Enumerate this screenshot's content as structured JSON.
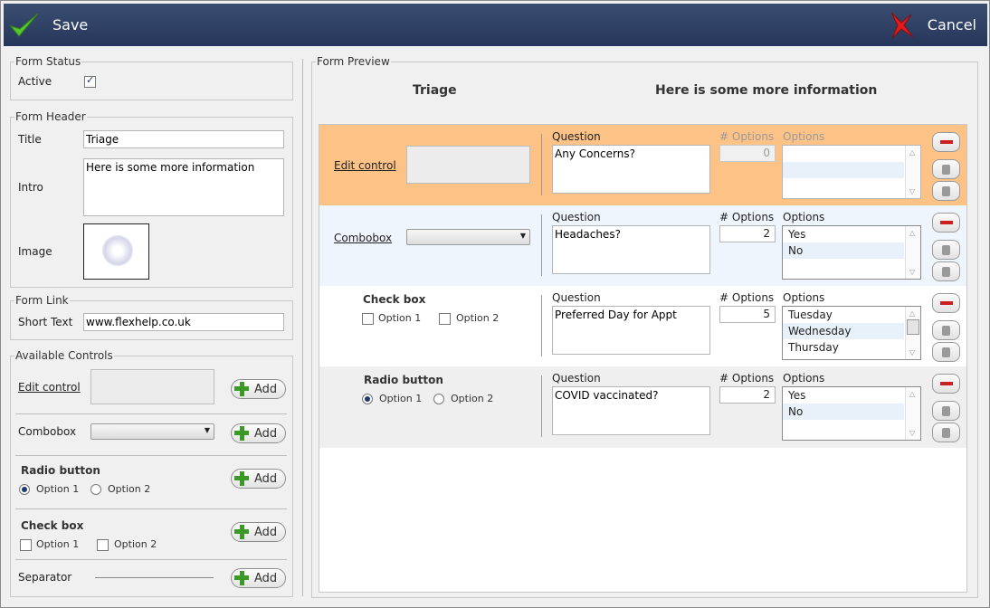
{
  "toolbar": {
    "save_label": "Save",
    "cancel_label": "Cancel"
  },
  "form_status": {
    "legend": "Form Status",
    "active_label": "Active",
    "active_checked": true
  },
  "form_header": {
    "legend": "Form Header",
    "title_label": "Title",
    "title_value": "Triage",
    "intro_label": "Intro",
    "intro_value": "Here is some more information",
    "image_label": "Image"
  },
  "form_link": {
    "legend": "Form Link",
    "short_text_label": "Short Text",
    "short_text_value": "www.flexhelp.co.uk"
  },
  "available_controls": {
    "legend": "Available Controls",
    "add_label": "Add",
    "edit_control_label": "Edit control",
    "combobox_label": "Combobox",
    "radio_label": "Radio button",
    "radio_option1": "Option 1",
    "radio_option2": "Option 2",
    "checkbox_label": "Check box",
    "checkbox_option1": "Option 1",
    "checkbox_option2": "Option 2",
    "separator_label": "Separator"
  },
  "preview": {
    "legend": "Form Preview",
    "title": "Triage",
    "intro": "Here is some more information",
    "question_label": "Question",
    "num_options_label": "# Options",
    "options_label": "Options",
    "rows": [
      {
        "type": "Edit control",
        "question": "Any Concerns?",
        "num_options": "0",
        "options": [
          "",
          "",
          ""
        ],
        "bg": "#fcc286"
      },
      {
        "type": "Combobox",
        "question": "Headaches?",
        "num_options": "2",
        "options": [
          "Yes",
          "No",
          ""
        ],
        "bg": "#eef5fd"
      },
      {
        "type": "Check box",
        "option1": "Option 1",
        "option2": "Option 2",
        "question": "Preferred Day for Appt",
        "num_options": "5",
        "options": [
          "Tuesday",
          "Wednesday",
          "Thursday"
        ],
        "bg": "#ffffff"
      },
      {
        "type": "Radio button",
        "option1": "Option 1",
        "option2": "Option 2",
        "question": "COVID vaccinated?",
        "num_options": "2",
        "options": [
          "Yes",
          "No",
          ""
        ],
        "bg": "#efefef"
      }
    ]
  },
  "colors": {
    "toolbar_bg": "#2f4266",
    "selected_row": "#fcc286",
    "delete_red": "#cc1f1f",
    "add_green": "#3a9a25"
  },
  "icons": {
    "save": "green-check-icon",
    "cancel": "red-x-icon",
    "delete": "minus-icon",
    "move_up": "arrow-up-icon",
    "move_down": "arrow-down-icon",
    "add": "plus-icon"
  }
}
